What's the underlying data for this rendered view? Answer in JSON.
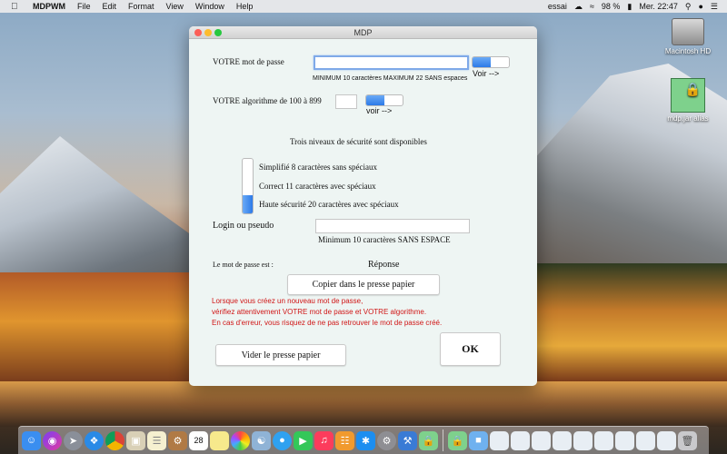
{
  "menubar": {
    "app_name": "MDPWM",
    "items": [
      "File",
      "Edit",
      "Format",
      "View",
      "Window",
      "Help"
    ],
    "user": "essai",
    "battery": "98 %",
    "clock": "Mer. 22:47"
  },
  "desktop": {
    "icons": [
      {
        "label": "Macintosh HD"
      },
      {
        "label": "mdp.jar alias"
      }
    ]
  },
  "window": {
    "title": "MDP",
    "password_label": "VOTRE mot de passe",
    "password_value": "",
    "password_hint": "MINIMUM 10 caractères MAXIMUM 22 SANS espaces",
    "voir1_label": "Voir -->",
    "voir1_level": 0.5,
    "algo_label": "VOTRE algorithme de 100 à 899",
    "algo_value": "",
    "voir2_label": "voir -->",
    "voir2_level": 0.5,
    "levels_title": "Trois niveaux de sécurité sont disponibles",
    "levels": [
      "Simplifié 8 caractères sans spéciaux",
      "Correct 11 caractères avec spéciaux",
      "Haute sécurité 20 caractères avec spéciaux"
    ],
    "level_slider_value": 0.33,
    "login_label": "Login ou pseudo",
    "login_value": "",
    "login_hint": "Minimum 10 caractères SANS ESPACE",
    "result_label": "Le mot de passe est :",
    "result_value": "Réponse",
    "copy_button": "Copier dans le presse papier",
    "warnings": [
      "Lorsque vous créez un nouveau mot de passe,",
      "vérifiez attentivement VOTRE mot de passe et VOTRE algorithme.",
      "En cas d'erreur, vous risquez de ne pas retrouver le mot de passe créé."
    ],
    "clear_button": "Vider le presse papier",
    "ok_button": "OK"
  },
  "dock": {
    "icons": [
      "finder-icon",
      "siri-icon",
      "launchpad-icon",
      "safari-icon",
      "chrome-icon",
      "preview-icon",
      "notes-icon",
      "contacts-icon",
      "calendar-icon",
      "stickies-icon",
      "photos-icon",
      "photobooth-icon",
      "messages-icon",
      "facetime-icon",
      "music-icon",
      "books-icon",
      "appstore-icon",
      "settings-icon",
      "xcode-icon",
      "jar-icon",
      "jar-icon",
      "folder-icon",
      "window-icon",
      "window-icon",
      "window-icon",
      "window-icon",
      "window-icon",
      "window-icon",
      "trash-icon"
    ],
    "calendar_day": "28"
  },
  "colors": {
    "accent": "#2c7ae8",
    "warning": "#d01515",
    "window_bg": "#eef5f3"
  }
}
